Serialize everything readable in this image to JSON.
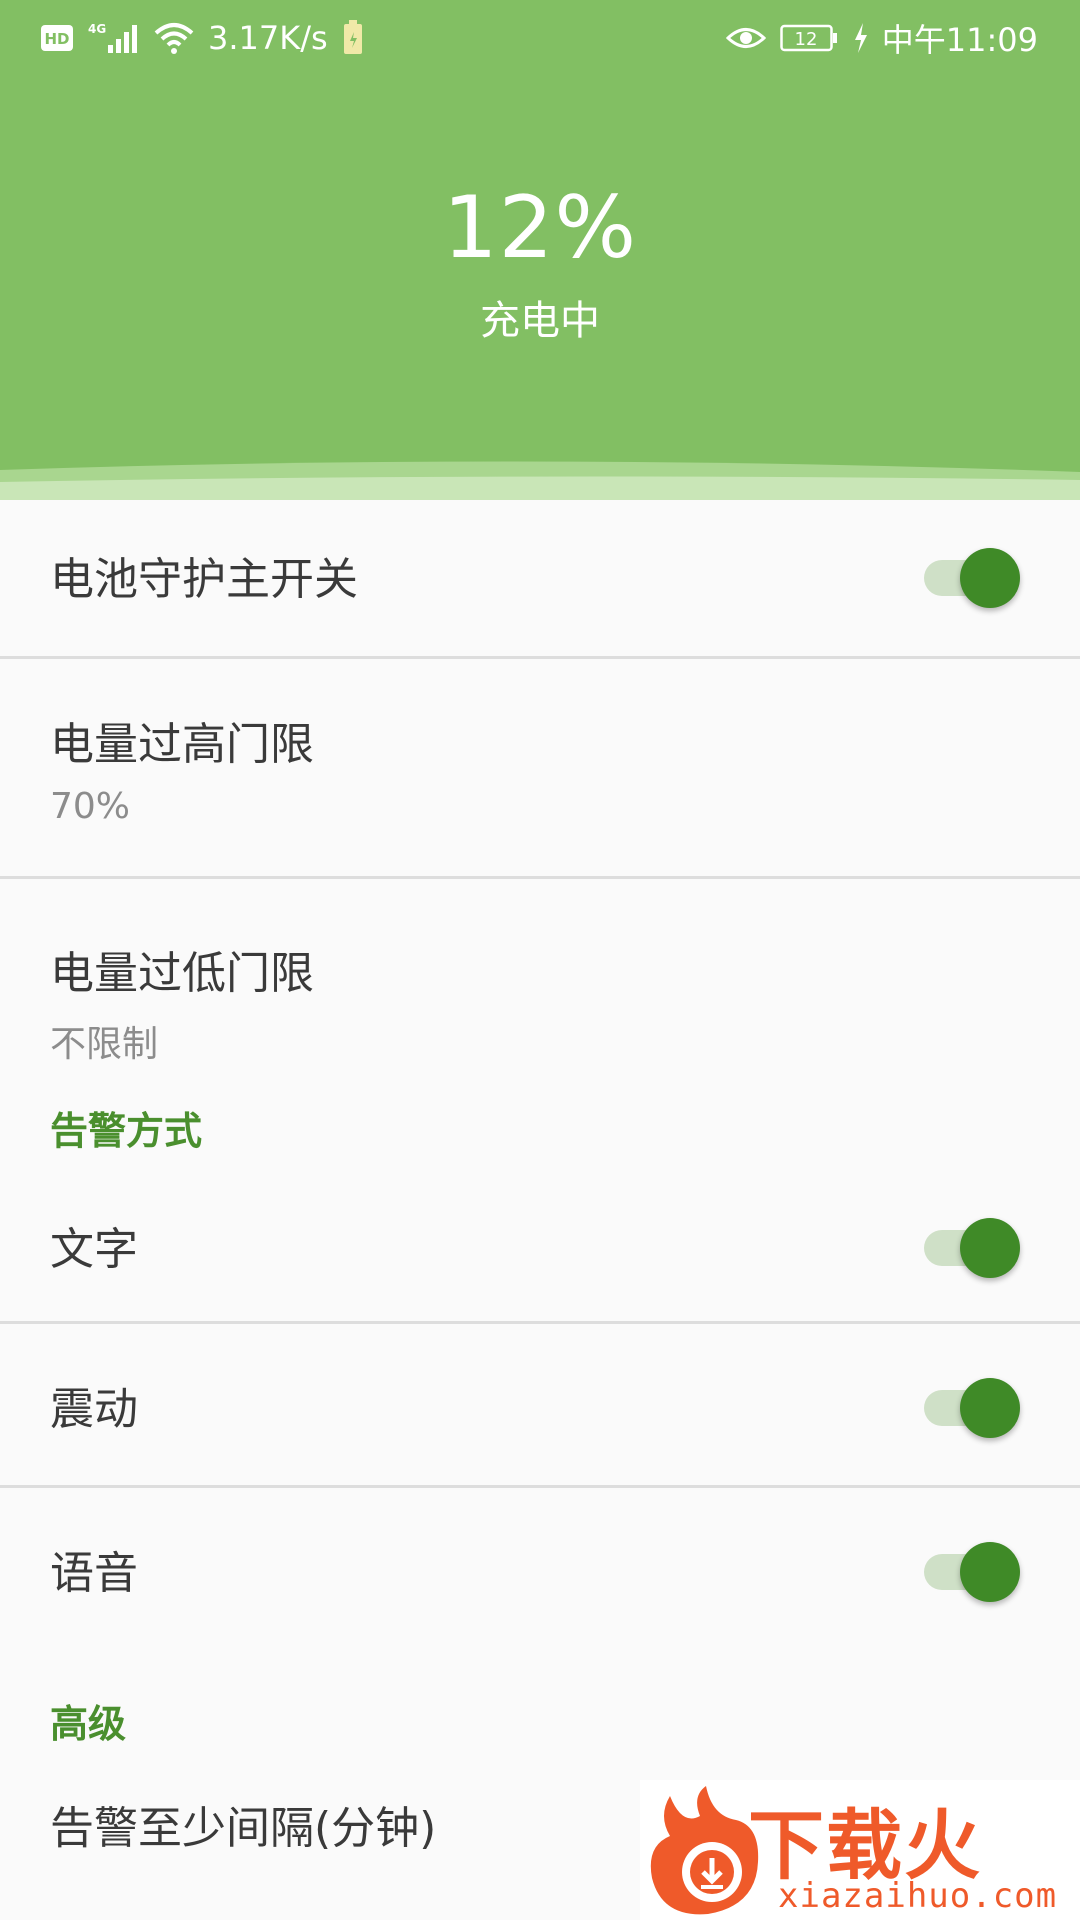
{
  "status_bar": {
    "hd": "HD",
    "network": "4G",
    "speed": "3.17K/s",
    "battery_small": "12",
    "time": "中午11:09",
    "icons": [
      "hd-icon",
      "signal-icon",
      "wifi-icon",
      "battery-charging-icon",
      "eye-icon",
      "battery-icon",
      "charging-bolt-icon"
    ]
  },
  "header": {
    "battery_level": "12%",
    "status": "充电中",
    "color": "#82bf63"
  },
  "list": {
    "master_switch": {
      "title": "电池守护主开关",
      "on": true
    },
    "high_threshold": {
      "title": "电量过高门限",
      "value": "70%"
    },
    "low_threshold": {
      "title": "电量过低门限",
      "value": "不限制"
    },
    "alert_section": "告警方式",
    "alert_text": {
      "title": "文字",
      "on": true
    },
    "alert_vibrate": {
      "title": "震动",
      "on": true
    },
    "alert_voice": {
      "title": "语音",
      "on": true
    },
    "advanced_section": "高级",
    "min_interval": {
      "title": "告警至少间隔(分钟)"
    }
  },
  "watermark": {
    "brand": "下载火",
    "domain": "xiazaihuo.com"
  },
  "colors": {
    "accent": "#3f8a27",
    "section": "#4a8f2e",
    "track": "#cfe0c7"
  }
}
